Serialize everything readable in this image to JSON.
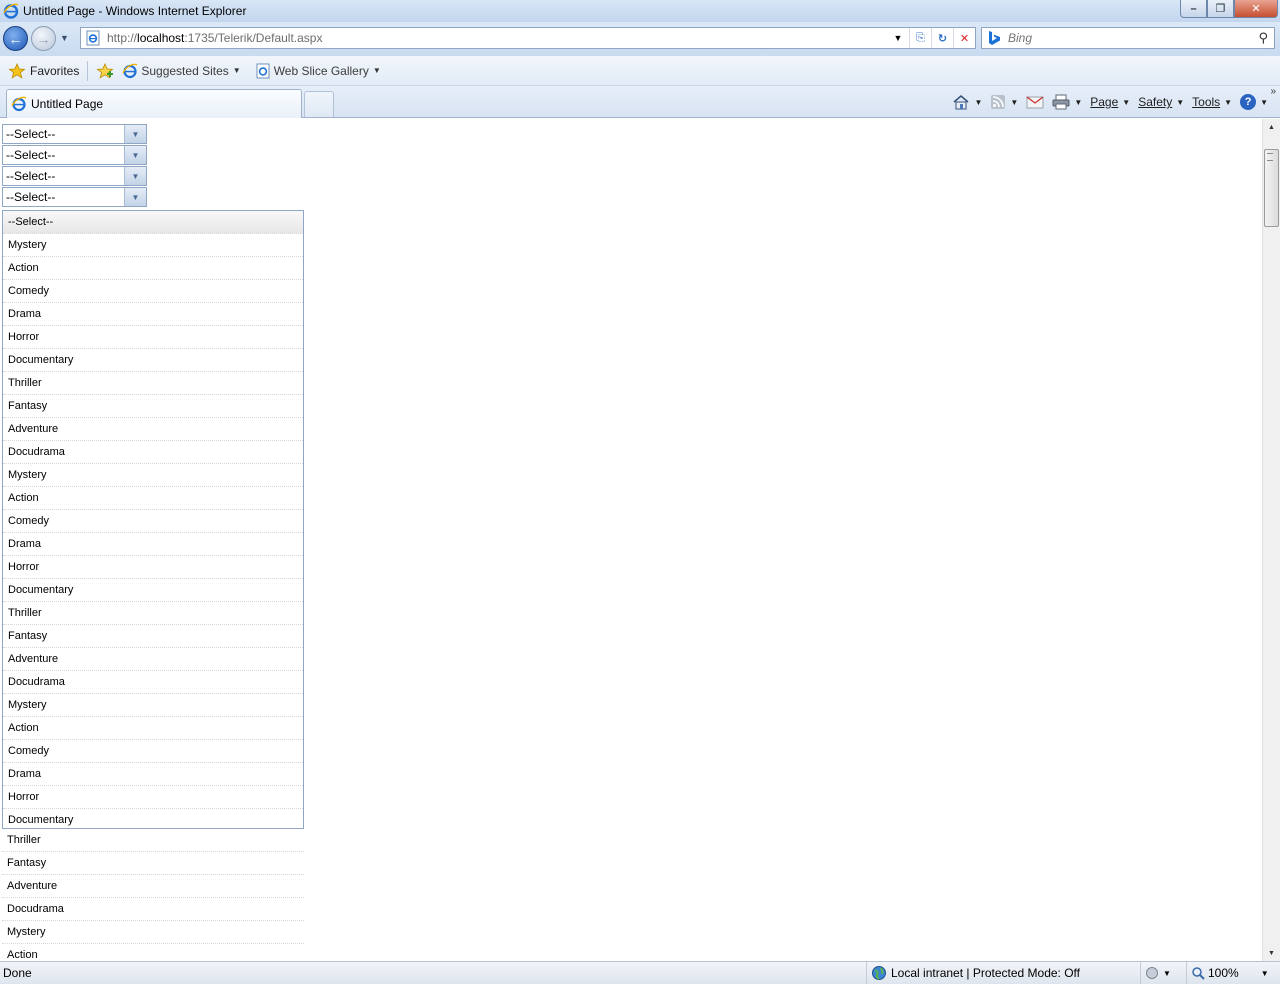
{
  "window": {
    "title": "Untitled Page - Windows Internet Explorer",
    "min_glyph": "–",
    "max_glyph": "❐",
    "close_glyph": "✕"
  },
  "address_bar": {
    "url_prefix": "http://",
    "url_host": "localhost",
    "url_rest": ":1735/Telerik/Default.aspx",
    "dropdown_glyph": "▼",
    "compat_glyph": "⎘",
    "refresh_glyph": "↻",
    "stop_glyph": "✕"
  },
  "search": {
    "placeholder": "Bing",
    "go_glyph": "⚲"
  },
  "favorites_bar": {
    "favorites_label": "Favorites",
    "suggested_sites_label": "Suggested Sites",
    "web_slice_gallery_label": "Web Slice Gallery"
  },
  "tabs": {
    "active_tab_label": "Untitled Page"
  },
  "command_bar": {
    "page_label": "Page",
    "safety_label": "Safety",
    "tools_label": "Tools",
    "help_glyph": "?",
    "chevron": "»"
  },
  "combos": [
    {
      "value": "--Select--"
    },
    {
      "value": "--Select--"
    },
    {
      "value": "--Select--"
    },
    {
      "value": "--Select--"
    }
  ],
  "dropdown": {
    "items": [
      "--Select--",
      "Mystery",
      "Action",
      "Comedy",
      "Drama",
      "Horror",
      "Documentary",
      "Thriller",
      "Fantasy",
      "Adventure",
      "Docudrama",
      "Mystery",
      "Action",
      "Comedy",
      "Drama",
      "Horror",
      "Documentary",
      "Thriller",
      "Fantasy",
      "Adventure",
      "Docudrama",
      "Mystery",
      "Action",
      "Comedy",
      "Drama",
      "Horror",
      "Documentary"
    ],
    "overflow_items": [
      "Thriller",
      "Fantasy",
      "Adventure",
      "Docudrama",
      "Mystery",
      "Action"
    ]
  },
  "status_bar": {
    "status_text": "Done",
    "zone_text": "Local intranet | Protected Mode: Off",
    "zoom_text": "100%"
  },
  "colors": {
    "accent_blue": "#1d56b5",
    "border": "#8fa6c4",
    "close_red": "#c54e2f"
  },
  "icons": [
    "ie-logo-icon",
    "back-arrow-icon",
    "forward-arrow-icon",
    "page-icon",
    "compatibility-view-icon",
    "refresh-icon",
    "stop-icon",
    "bing-icon",
    "search-icon",
    "star-icon",
    "add-favorite-icon",
    "home-icon",
    "feeds-icon",
    "mail-icon",
    "print-icon",
    "help-icon",
    "globe-icon",
    "zoom-icon"
  ]
}
